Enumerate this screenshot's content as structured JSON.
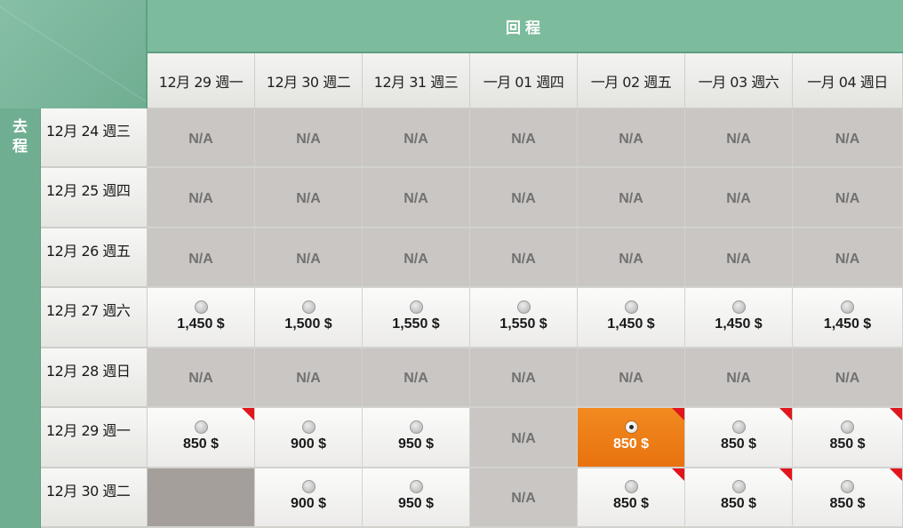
{
  "header": {
    "return_label": "回程",
    "depart_label_1": "去",
    "depart_label_2": "程"
  },
  "return_dates": [
    "12月 29 週一",
    "12月 30 週二",
    "12月 31 週三",
    "一月 01 週四",
    "一月 02 週五",
    "一月 03 週六",
    "一月 04 週日"
  ],
  "rows": [
    {
      "date": "12月 24 週三",
      "cells": [
        {
          "type": "na",
          "text": "N/A"
        },
        {
          "type": "na",
          "text": "N/A"
        },
        {
          "type": "na",
          "text": "N/A"
        },
        {
          "type": "na",
          "text": "N/A"
        },
        {
          "type": "na",
          "text": "N/A"
        },
        {
          "type": "na",
          "text": "N/A"
        },
        {
          "type": "na",
          "text": "N/A"
        }
      ]
    },
    {
      "date": "12月 25 週四",
      "cells": [
        {
          "type": "na",
          "text": "N/A"
        },
        {
          "type": "na",
          "text": "N/A"
        },
        {
          "type": "na",
          "text": "N/A"
        },
        {
          "type": "na",
          "text": "N/A"
        },
        {
          "type": "na",
          "text": "N/A"
        },
        {
          "type": "na",
          "text": "N/A"
        },
        {
          "type": "na",
          "text": "N/A"
        }
      ]
    },
    {
      "date": "12月 26 週五",
      "cells": [
        {
          "type": "na",
          "text": "N/A"
        },
        {
          "type": "na",
          "text": "N/A"
        },
        {
          "type": "na",
          "text": "N/A"
        },
        {
          "type": "na",
          "text": "N/A"
        },
        {
          "type": "na",
          "text": "N/A"
        },
        {
          "type": "na",
          "text": "N/A"
        },
        {
          "type": "na",
          "text": "N/A"
        }
      ]
    },
    {
      "date": "12月 27 週六",
      "cells": [
        {
          "type": "price",
          "text": "1,450 $",
          "flag": false,
          "selected": false
        },
        {
          "type": "price",
          "text": "1,500 $",
          "flag": false,
          "selected": false
        },
        {
          "type": "price",
          "text": "1,550 $",
          "flag": false,
          "selected": false
        },
        {
          "type": "price",
          "text": "1,550 $",
          "flag": false,
          "selected": false
        },
        {
          "type": "price",
          "text": "1,450 $",
          "flag": false,
          "selected": false
        },
        {
          "type": "price",
          "text": "1,450 $",
          "flag": false,
          "selected": false
        },
        {
          "type": "price",
          "text": "1,450 $",
          "flag": false,
          "selected": false
        }
      ]
    },
    {
      "date": "12月 28 週日",
      "cells": [
        {
          "type": "na",
          "text": "N/A"
        },
        {
          "type": "na",
          "text": "N/A"
        },
        {
          "type": "na",
          "text": "N/A"
        },
        {
          "type": "na",
          "text": "N/A"
        },
        {
          "type": "na",
          "text": "N/A"
        },
        {
          "type": "na",
          "text": "N/A"
        },
        {
          "type": "na",
          "text": "N/A"
        }
      ]
    },
    {
      "date": "12月 29 週一",
      "cells": [
        {
          "type": "price",
          "text": "850 $",
          "flag": true,
          "selected": false
        },
        {
          "type": "price",
          "text": "900 $",
          "flag": false,
          "selected": false
        },
        {
          "type": "price",
          "text": "950 $",
          "flag": false,
          "selected": false
        },
        {
          "type": "na",
          "text": "N/A"
        },
        {
          "type": "price",
          "text": "850 $",
          "flag": true,
          "selected": true
        },
        {
          "type": "price",
          "text": "850 $",
          "flag": true,
          "selected": false
        },
        {
          "type": "price",
          "text": "850 $",
          "flag": true,
          "selected": false
        }
      ]
    },
    {
      "date": "12月 30 週二",
      "cells": [
        {
          "type": "blank",
          "text": ""
        },
        {
          "type": "price",
          "text": "900 $",
          "flag": false,
          "selected": false
        },
        {
          "type": "price",
          "text": "950 $",
          "flag": false,
          "selected": false
        },
        {
          "type": "na",
          "text": "N/A"
        },
        {
          "type": "price",
          "text": "850 $",
          "flag": true,
          "selected": false
        },
        {
          "type": "price",
          "text": "850 $",
          "flag": true,
          "selected": false
        },
        {
          "type": "price",
          "text": "850 $",
          "flag": true,
          "selected": false
        }
      ]
    }
  ],
  "colors": {
    "header_green": "#7cbb9c",
    "side_green": "#6fae91",
    "selected_orange": "#f28a20",
    "na_gray": "#cac6c4",
    "flag_red": "#e0161c"
  }
}
